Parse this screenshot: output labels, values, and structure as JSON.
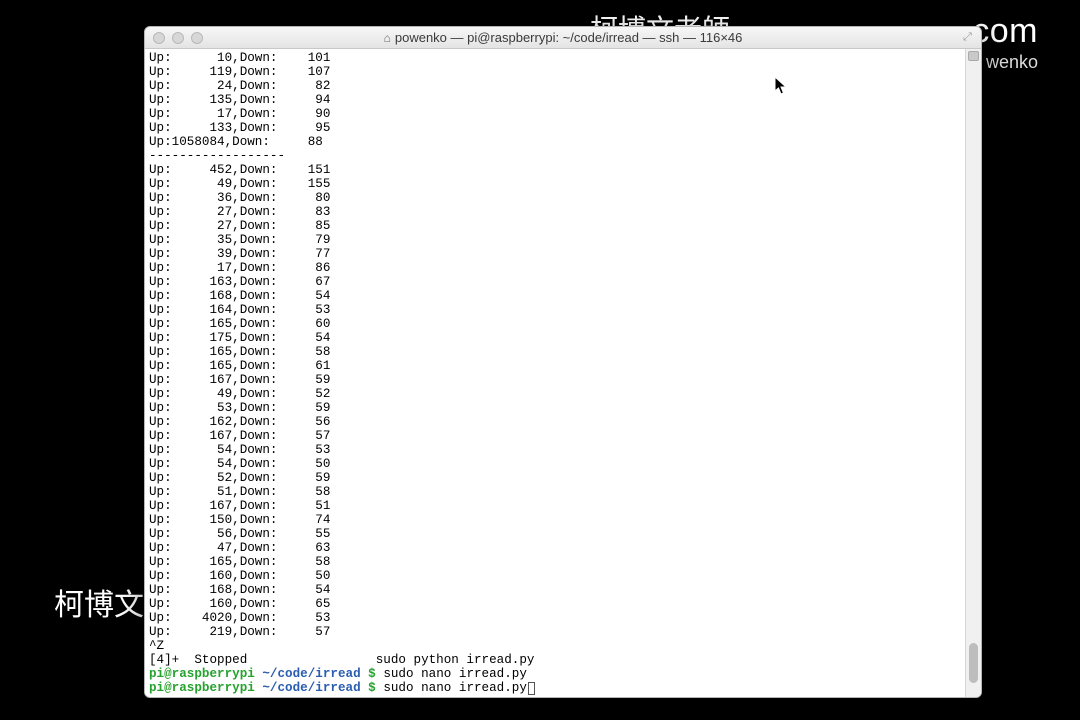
{
  "background": {
    "top_cn_partial": "柯博文老師",
    "top_com": ".com",
    "wenko": "wenko",
    "bottom_cn": "柯博文"
  },
  "window": {
    "title": "powenko — pi@raspberrypi: ~/code/irread — ssh — 116×46"
  },
  "output_lines": [
    "Up:      10,Down:    101",
    "Up:     119,Down:    107",
    "Up:      24,Down:     82",
    "Up:     135,Down:     94",
    "Up:      17,Down:     90",
    "Up:     133,Down:     95",
    "Up:1058084,Down:     88",
    "------------------",
    "Up:     452,Down:    151",
    "Up:      49,Down:    155",
    "Up:      36,Down:     80",
    "Up:      27,Down:     83",
    "Up:      27,Down:     85",
    "Up:      35,Down:     79",
    "Up:      39,Down:     77",
    "Up:      17,Down:     86",
    "Up:     163,Down:     67",
    "Up:     168,Down:     54",
    "Up:     164,Down:     53",
    "Up:     165,Down:     60",
    "Up:     175,Down:     54",
    "Up:     165,Down:     58",
    "Up:     165,Down:     61",
    "Up:     167,Down:     59",
    "Up:      49,Down:     52",
    "Up:      53,Down:     59",
    "Up:     162,Down:     56",
    "Up:     167,Down:     57",
    "Up:      54,Down:     53",
    "Up:      54,Down:     50",
    "Up:      52,Down:     59",
    "Up:      51,Down:     58",
    "Up:     167,Down:     51",
    "Up:     150,Down:     74",
    "Up:      56,Down:     55",
    "Up:      47,Down:     63",
    "Up:     165,Down:     58",
    "Up:     160,Down:     50",
    "Up:     168,Down:     54",
    "Up:     160,Down:     65",
    "Up:    4020,Down:     53",
    "Up:     219,Down:     57"
  ],
  "ctrl_z": "^Z",
  "stopped_line": "[4]+  Stopped                 sudo python irread.py",
  "prompts": [
    {
      "user": "pi@raspberrypi",
      "path": "~/code/irread",
      "dollar": " $ ",
      "cmd": "sudo nano irread.py"
    },
    {
      "user": "pi@raspberrypi",
      "path": "~/code/irread",
      "dollar": " $ ",
      "cmd": "sudo nano irread.py"
    }
  ]
}
